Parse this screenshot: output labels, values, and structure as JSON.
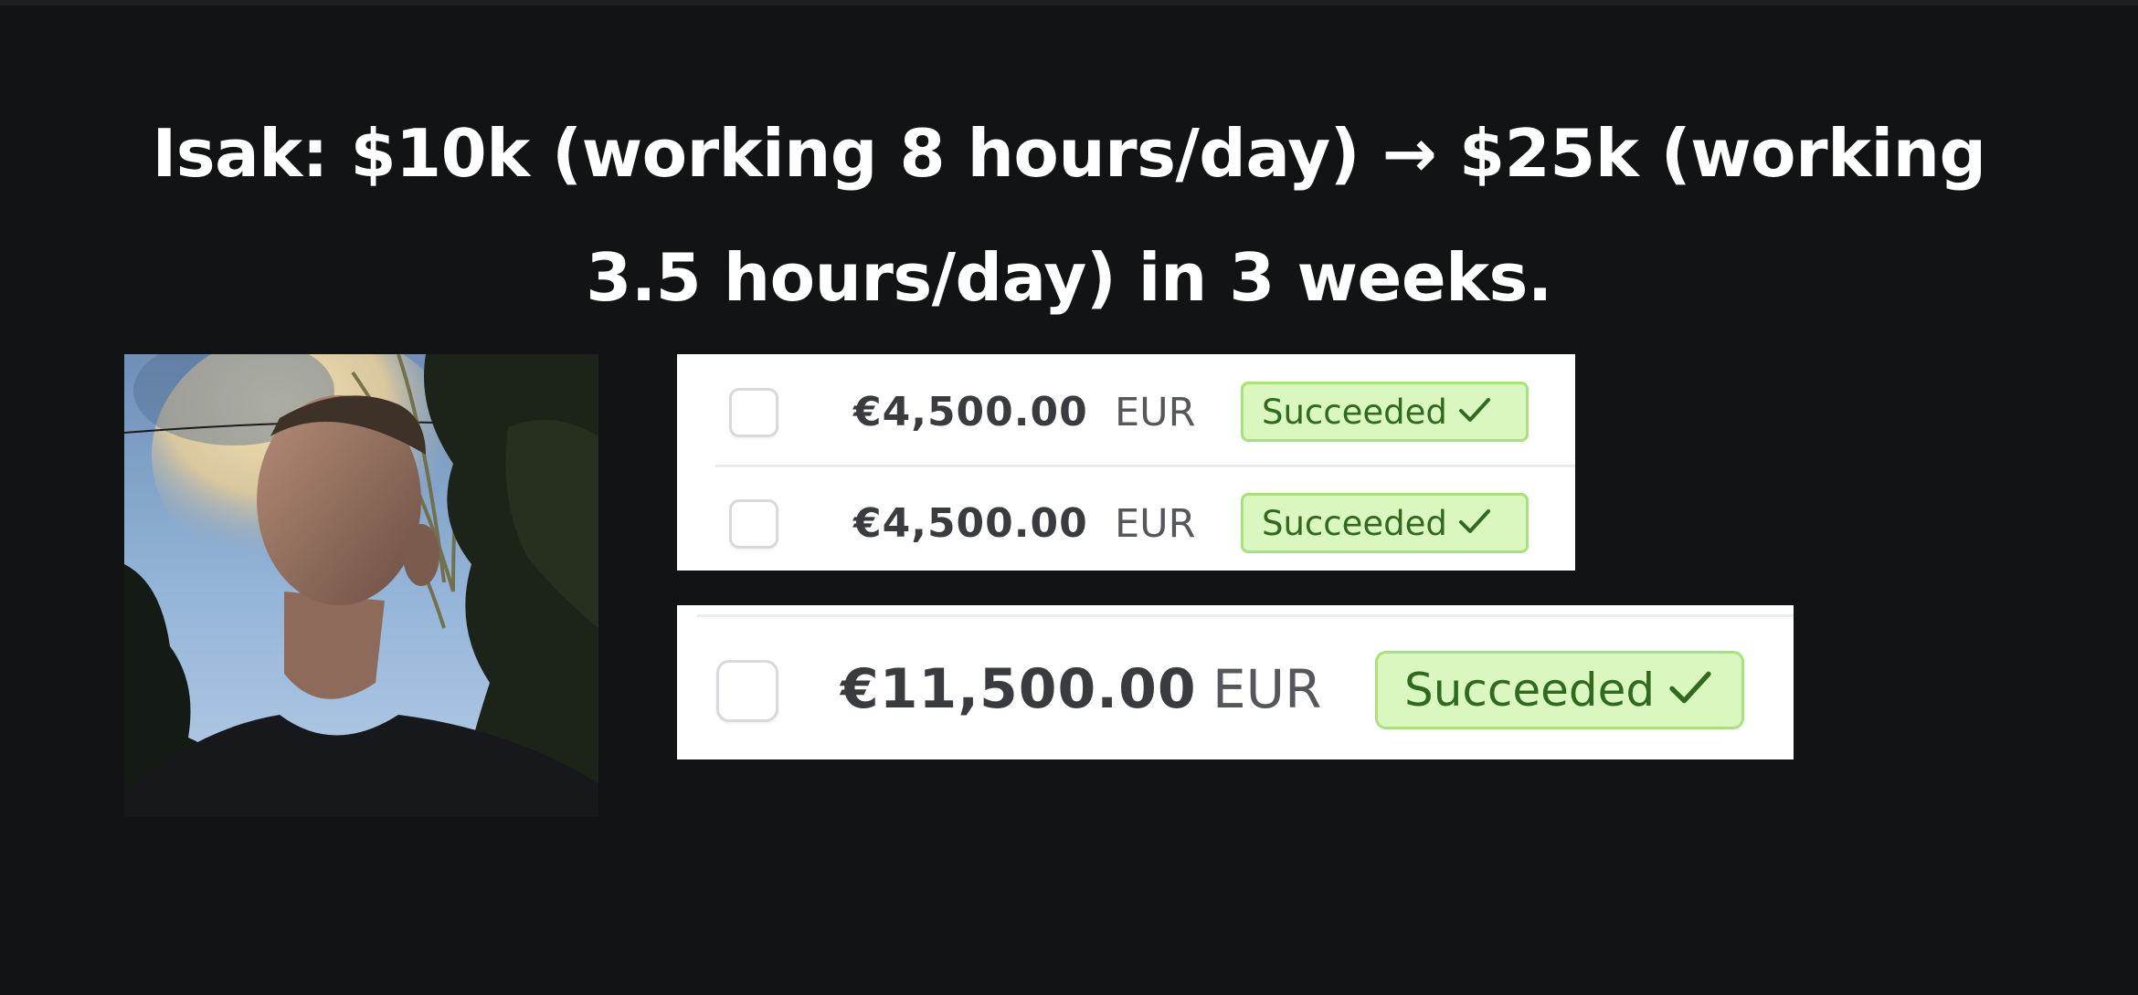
{
  "headline": {
    "line1": "Isak: $10k (working 8 hours/day) → $25k (working",
    "line2": "3.5 hours/day) in 3 weeks."
  },
  "photo": {
    "subject": "portrait-photo",
    "sky_color": "#8fb2d6",
    "foliage_color": "#1c2419"
  },
  "payments_small": [
    {
      "amount": "€4,500.00",
      "currency": "EUR",
      "status": "Succeeded"
    },
    {
      "amount": "€4,500.00",
      "currency": "EUR",
      "status": "Succeeded"
    }
  ],
  "payment_large": {
    "amount": "€11,500.00",
    "currency": "EUR",
    "status": "Succeeded"
  },
  "colors": {
    "background": "#121315",
    "badge_background": "#d9f7be",
    "badge_border": "#a9e27a",
    "badge_text": "#2f6a1f"
  },
  "icons": {
    "status": "checkmark-icon",
    "row_select": "checkbox"
  }
}
